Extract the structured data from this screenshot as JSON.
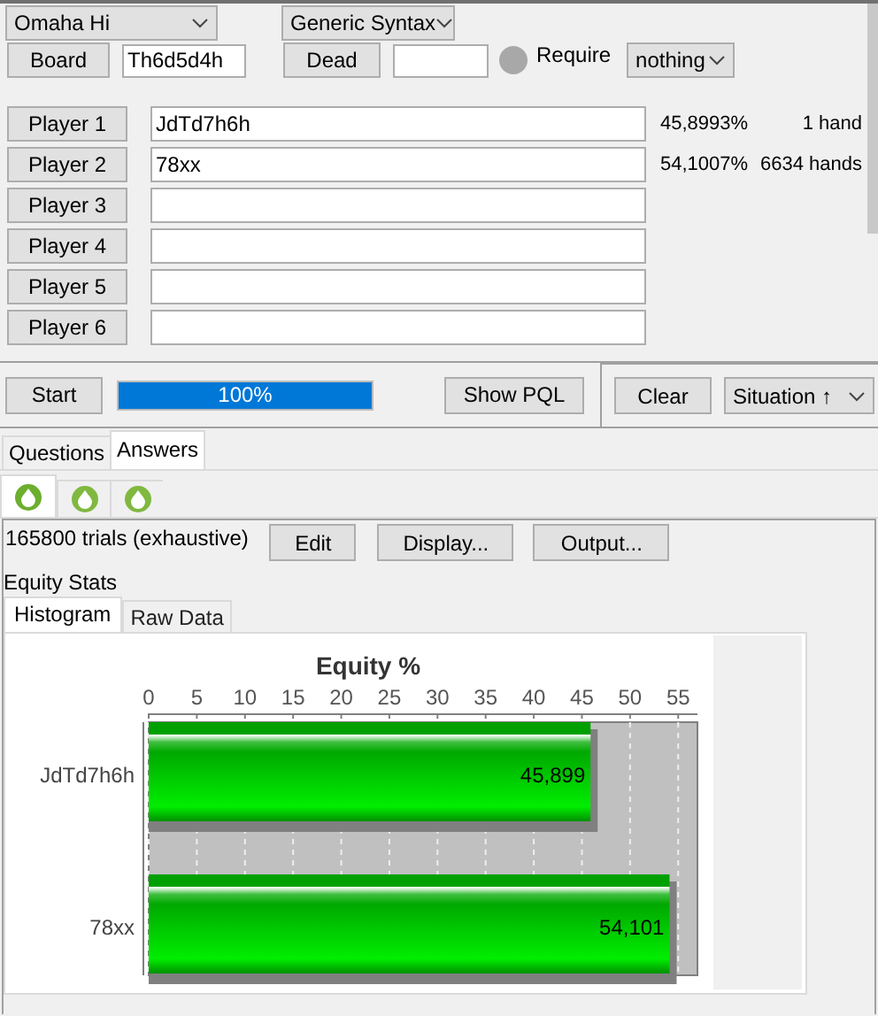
{
  "game_select": {
    "value": "Omaha Hi"
  },
  "syntax_select": {
    "value": "Generic Syntax"
  },
  "board": {
    "button": "Board",
    "value": "Th6d5d4h"
  },
  "dead": {
    "button": "Dead"
  },
  "require": {
    "label": "Require",
    "value": "nothing"
  },
  "players": [
    {
      "label": "Player 1",
      "hand": "JdTd7h6h",
      "equity": "45,8993%",
      "count": "1 hand"
    },
    {
      "label": "Player 2",
      "hand": "78xx",
      "equity": "54,1007%",
      "count": "6634 hands"
    },
    {
      "label": "Player 3"
    },
    {
      "label": "Player 4"
    },
    {
      "label": "Player 5"
    },
    {
      "label": "Player 6"
    }
  ],
  "toolbar": {
    "start": "Start",
    "progress": {
      "level": 1,
      "text": "100%"
    },
    "show_pql": "Show PQL",
    "clear": "Clear",
    "sort": "Situation ↑"
  },
  "tabs": [
    {
      "label": "Questions",
      "selected": false
    },
    {
      "label": "Answers",
      "selected": true
    }
  ],
  "icon_tabs": [
    {
      "selected": true
    },
    {
      "selected": false
    },
    {
      "selected": false
    }
  ],
  "results": {
    "trials": "165800 trials (exhaustive)",
    "buttons": [
      "Edit",
      "Display...",
      "Output..."
    ],
    "section_title": "Equity Stats",
    "subtabs": [
      {
        "label": "Histogram",
        "selected": true
      },
      {
        "label": "Raw Data",
        "selected": false
      }
    ],
    "chart_data": {
      "type": "bar",
      "orientation": "horizontal",
      "title": "Equity %",
      "categories": [
        "JdTd7h6h",
        "78xx"
      ],
      "series": [
        {
          "color": "#00c000",
          "values": [
            45.899,
            54.101
          ]
        }
      ],
      "grid": true,
      "xticks": [
        0,
        5,
        10,
        15,
        20,
        25,
        30,
        35,
        40,
        45,
        50,
        55
      ],
      "xlim": [
        0,
        57
      ],
      "value_labels": [
        "45,899",
        "54,101"
      ]
    }
  }
}
